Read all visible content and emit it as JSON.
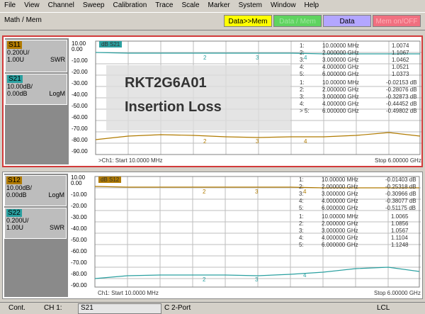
{
  "menu": [
    "File",
    "View",
    "Channel",
    "Sweep",
    "Calibration",
    "Trace",
    "Scale",
    "Marker",
    "System",
    "Window",
    "Help"
  ],
  "toolbar": {
    "label": "Math / Mem",
    "data_to_mem": "Data>>Mem",
    "data_mem": "Data / Mem",
    "data": "Data",
    "mem_onoff": "Mem on/OFF"
  },
  "colors": {
    "accent_s11": "#b07a00",
    "accent_s21": "#2aa0a0",
    "yellow": "#ffff00",
    "green": "#5fd35f",
    "lilac": "#b3a6ff",
    "pink": "#f07080"
  },
  "top": {
    "trace1": {
      "name": "S11",
      "scale": "0.200U/",
      "ref": "1.00U",
      "fmt": "SWR"
    },
    "trace2": {
      "name": "S21",
      "scale": "10.00dB/",
      "ref": "0.00dB",
      "fmt": "LogM"
    },
    "ylabels": [
      "10.00",
      "0.00",
      "-10.00",
      "-20.00",
      "-30.00",
      "-40.00",
      "-50.00",
      "-60.00",
      "-70.00",
      "-80.00",
      "-90.00"
    ],
    "active_label": "dB S21",
    "start": ">Ch1: Start 10.0000 MHz",
    "stop": "Stop 6.00000 GHz",
    "markers": [
      {
        "n": "1:",
        "f": "10.00000 MHz",
        "v": "1.0074"
      },
      {
        "n": "2:",
        "f": "2.000000 GHz",
        "v": "1.1067"
      },
      {
        "n": "3:",
        "f": "3.000000 GHz",
        "v": "1.0462"
      },
      {
        "n": "4:",
        "f": "4.000000 GHz",
        "v": "1.0521"
      },
      {
        "n": "5:",
        "f": "6.000000 GHz",
        "v": "1.0373"
      },
      {
        "n": "1:",
        "f": "10.00000 MHz",
        "v": "-0.02153 dB"
      },
      {
        "n": "2:",
        "f": "2.000000 GHz",
        "v": "-0.28076 dB"
      },
      {
        "n": "3:",
        "f": "3.000000 GHz",
        "v": "-0.32873 dB"
      },
      {
        "n": "4:",
        "f": "4.000000 GHz",
        "v": "-0.44452 dB"
      },
      {
        "n": "> 5:",
        "f": "6.000000 GHz",
        "v": "-0.49802 dB"
      }
    ]
  },
  "bottom": {
    "trace1": {
      "name": "S12",
      "scale": "10.00dB/",
      "ref": "0.00dB",
      "fmt": "LogM"
    },
    "trace2": {
      "name": "S22",
      "scale": "0.200U/",
      "ref": "1.00U",
      "fmt": "SWR"
    },
    "ylabels": [
      "10.00",
      "0.00",
      "-10.00",
      "-20.00",
      "-30.00",
      "-40.00",
      "-50.00",
      "-60.00",
      "-70.00",
      "-80.00",
      "-90.00"
    ],
    "active_label": "dB S12",
    "start": "Ch1: Start 10.0000 MHz",
    "stop": "Stop 6.00000 GHz",
    "markers": [
      {
        "n": "1:",
        "f": "10.00000 MHz",
        "v": "-0.01403 dB"
      },
      {
        "n": "2:",
        "f": "2.000000 GHz",
        "v": "-0.25318 dB"
      },
      {
        "n": "3:",
        "f": "3.000000 GHz",
        "v": "-0.30966 dB"
      },
      {
        "n": "4:",
        "f": "4.000000 GHz",
        "v": "-0.38077 dB"
      },
      {
        "n": "5:",
        "f": "6.000000 GHz",
        "v": "-0.51175 dB"
      },
      {
        "n": "1:",
        "f": "10.00000 MHz",
        "v": "1.0065"
      },
      {
        "n": "2:",
        "f": "2.000000 GHz",
        "v": "1.0856"
      },
      {
        "n": "3:",
        "f": "3.000000 GHz",
        "v": "1.0567"
      },
      {
        "n": "4:",
        "f": "4.000000 GHz",
        "v": "1.1104"
      },
      {
        "n": "5:",
        "f": "6.000000 GHz",
        "v": "1.1248"
      }
    ]
  },
  "overlay": {
    "line1": "RKT2G6A01",
    "line2": "Insertion Loss"
  },
  "status": {
    "mode": "Cont.",
    "channel": "CH 1:",
    "trace": "S21",
    "port": "C  2-Port",
    "lcl": "LCL"
  }
}
